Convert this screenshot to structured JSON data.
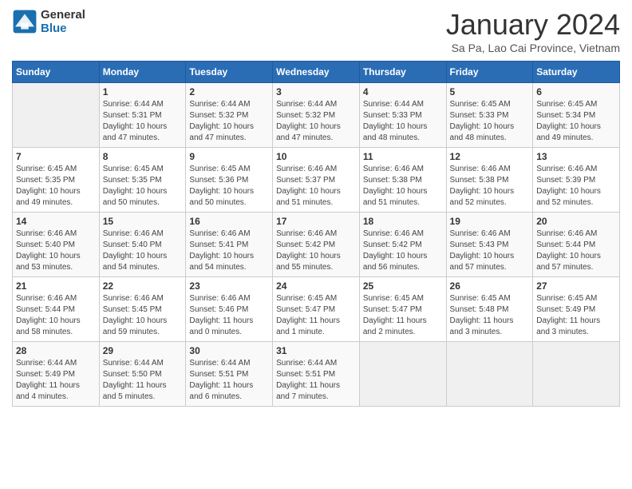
{
  "logo": {
    "line1": "General",
    "line2": "Blue"
  },
  "title": "January 2024",
  "subtitle": "Sa Pa, Lao Cai Province, Vietnam",
  "days_of_week": [
    "Sunday",
    "Monday",
    "Tuesday",
    "Wednesday",
    "Thursday",
    "Friday",
    "Saturday"
  ],
  "weeks": [
    [
      {
        "num": "",
        "info": ""
      },
      {
        "num": "1",
        "info": "Sunrise: 6:44 AM\nSunset: 5:31 PM\nDaylight: 10 hours\nand 47 minutes."
      },
      {
        "num": "2",
        "info": "Sunrise: 6:44 AM\nSunset: 5:32 PM\nDaylight: 10 hours\nand 47 minutes."
      },
      {
        "num": "3",
        "info": "Sunrise: 6:44 AM\nSunset: 5:32 PM\nDaylight: 10 hours\nand 47 minutes."
      },
      {
        "num": "4",
        "info": "Sunrise: 6:44 AM\nSunset: 5:33 PM\nDaylight: 10 hours\nand 48 minutes."
      },
      {
        "num": "5",
        "info": "Sunrise: 6:45 AM\nSunset: 5:33 PM\nDaylight: 10 hours\nand 48 minutes."
      },
      {
        "num": "6",
        "info": "Sunrise: 6:45 AM\nSunset: 5:34 PM\nDaylight: 10 hours\nand 49 minutes."
      }
    ],
    [
      {
        "num": "7",
        "info": "Sunrise: 6:45 AM\nSunset: 5:35 PM\nDaylight: 10 hours\nand 49 minutes."
      },
      {
        "num": "8",
        "info": "Sunrise: 6:45 AM\nSunset: 5:35 PM\nDaylight: 10 hours\nand 50 minutes."
      },
      {
        "num": "9",
        "info": "Sunrise: 6:45 AM\nSunset: 5:36 PM\nDaylight: 10 hours\nand 50 minutes."
      },
      {
        "num": "10",
        "info": "Sunrise: 6:46 AM\nSunset: 5:37 PM\nDaylight: 10 hours\nand 51 minutes."
      },
      {
        "num": "11",
        "info": "Sunrise: 6:46 AM\nSunset: 5:38 PM\nDaylight: 10 hours\nand 51 minutes."
      },
      {
        "num": "12",
        "info": "Sunrise: 6:46 AM\nSunset: 5:38 PM\nDaylight: 10 hours\nand 52 minutes."
      },
      {
        "num": "13",
        "info": "Sunrise: 6:46 AM\nSunset: 5:39 PM\nDaylight: 10 hours\nand 52 minutes."
      }
    ],
    [
      {
        "num": "14",
        "info": "Sunrise: 6:46 AM\nSunset: 5:40 PM\nDaylight: 10 hours\nand 53 minutes."
      },
      {
        "num": "15",
        "info": "Sunrise: 6:46 AM\nSunset: 5:40 PM\nDaylight: 10 hours\nand 54 minutes."
      },
      {
        "num": "16",
        "info": "Sunrise: 6:46 AM\nSunset: 5:41 PM\nDaylight: 10 hours\nand 54 minutes."
      },
      {
        "num": "17",
        "info": "Sunrise: 6:46 AM\nSunset: 5:42 PM\nDaylight: 10 hours\nand 55 minutes."
      },
      {
        "num": "18",
        "info": "Sunrise: 6:46 AM\nSunset: 5:42 PM\nDaylight: 10 hours\nand 56 minutes."
      },
      {
        "num": "19",
        "info": "Sunrise: 6:46 AM\nSunset: 5:43 PM\nDaylight: 10 hours\nand 57 minutes."
      },
      {
        "num": "20",
        "info": "Sunrise: 6:46 AM\nSunset: 5:44 PM\nDaylight: 10 hours\nand 57 minutes."
      }
    ],
    [
      {
        "num": "21",
        "info": "Sunrise: 6:46 AM\nSunset: 5:44 PM\nDaylight: 10 hours\nand 58 minutes."
      },
      {
        "num": "22",
        "info": "Sunrise: 6:46 AM\nSunset: 5:45 PM\nDaylight: 10 hours\nand 59 minutes."
      },
      {
        "num": "23",
        "info": "Sunrise: 6:46 AM\nSunset: 5:46 PM\nDaylight: 11 hours\nand 0 minutes."
      },
      {
        "num": "24",
        "info": "Sunrise: 6:45 AM\nSunset: 5:47 PM\nDaylight: 11 hours\nand 1 minute."
      },
      {
        "num": "25",
        "info": "Sunrise: 6:45 AM\nSunset: 5:47 PM\nDaylight: 11 hours\nand 2 minutes."
      },
      {
        "num": "26",
        "info": "Sunrise: 6:45 AM\nSunset: 5:48 PM\nDaylight: 11 hours\nand 3 minutes."
      },
      {
        "num": "27",
        "info": "Sunrise: 6:45 AM\nSunset: 5:49 PM\nDaylight: 11 hours\nand 3 minutes."
      }
    ],
    [
      {
        "num": "28",
        "info": "Sunrise: 6:44 AM\nSunset: 5:49 PM\nDaylight: 11 hours\nand 4 minutes."
      },
      {
        "num": "29",
        "info": "Sunrise: 6:44 AM\nSunset: 5:50 PM\nDaylight: 11 hours\nand 5 minutes."
      },
      {
        "num": "30",
        "info": "Sunrise: 6:44 AM\nSunset: 5:51 PM\nDaylight: 11 hours\nand 6 minutes."
      },
      {
        "num": "31",
        "info": "Sunrise: 6:44 AM\nSunset: 5:51 PM\nDaylight: 11 hours\nand 7 minutes."
      },
      {
        "num": "",
        "info": ""
      },
      {
        "num": "",
        "info": ""
      },
      {
        "num": "",
        "info": ""
      }
    ]
  ]
}
